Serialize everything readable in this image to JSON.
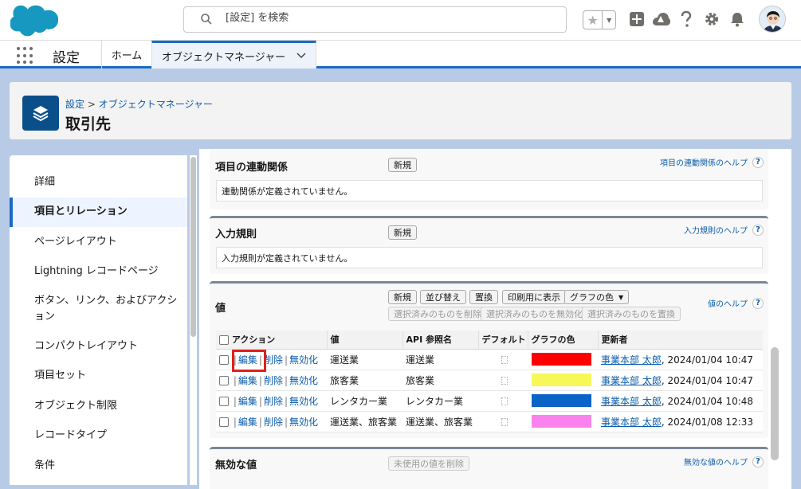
{
  "header": {
    "search_placeholder": "[設定] を検索",
    "icons": [
      "star-icon",
      "add-icon",
      "trailhead-icon",
      "help-icon",
      "setup-gear-icon",
      "notification-bell-icon",
      "avatar"
    ]
  },
  "nav": {
    "app_name": "設定",
    "tabs": [
      {
        "label": "ホーム"
      },
      {
        "label": "オブジェクトマネージャー"
      }
    ]
  },
  "page": {
    "breadcrumb_root": "設定",
    "breadcrumb_sep": " > ",
    "breadcrumb_current": "オブジェクトマネージャー",
    "title": "取引先"
  },
  "sidebar": {
    "items": [
      {
        "label": "詳細"
      },
      {
        "label": "項目とリレーション"
      },
      {
        "label": "ページレイアウト"
      },
      {
        "label": "Lightning レコードページ"
      },
      {
        "label": "ボタン、リンク、およびアクション"
      },
      {
        "label": "コンパクトレイアウト"
      },
      {
        "label": "項目セット"
      },
      {
        "label": "オブジェクト制限"
      },
      {
        "label": "レコードタイプ"
      },
      {
        "label": "条件"
      }
    ]
  },
  "dependencies": {
    "title": "項目の連動関係",
    "new_button": "新規",
    "help": "項目の連動関係のヘルプ",
    "help_q": "?",
    "empty": "連動関係が定義されていません。"
  },
  "validation": {
    "title": "入力規則",
    "new_button": "新規",
    "help": "入力規則のヘルプ",
    "help_q": "?",
    "empty": "入力規則が定義されていません。"
  },
  "values": {
    "title": "値",
    "buttons": {
      "new": "新規",
      "reorder": "並び替え",
      "replace": "置換",
      "print": "印刷用に表示",
      "chart_color": "グラフの色",
      "chart_color_caret": "▼",
      "delete_selected": "選択済みのものを削除",
      "disable_selected": "選択済みのものを無効化",
      "replace_selected": "選択済みのものを置換"
    },
    "help": "値のヘルプ",
    "help_q": "?",
    "columns": [
      "アクション",
      "値",
      "API 参照名",
      "デフォルト",
      "グラフの色",
      "更新者"
    ],
    "row_actions": {
      "edit": "編集",
      "delete": "削除",
      "disable": "無効化",
      "sep": "|"
    },
    "rows": [
      {
        "value": "運送業",
        "api": "運送業",
        "color": "#ff0000",
        "user": "事業本部 太郎",
        "date": ", 2024/01/04 10:47"
      },
      {
        "value": "旅客業",
        "api": "旅客業",
        "color": "#f7f757",
        "user": "事業本部 太郎",
        "date": ", 2024/01/04 10:47"
      },
      {
        "value": "レンタカー業",
        "api": "レンタカー業",
        "color": "#0a64c8",
        "user": "事業本部 太郎",
        "date": ", 2024/01/04 10:48"
      },
      {
        "value": "運送業、旅客業",
        "api": "運送業、旅客業",
        "color": "#fa82ef",
        "user": "事業本部 太郎",
        "date": ", 2024/01/08 12:33"
      }
    ]
  },
  "inactive": {
    "title": "無効な値",
    "delete_unused": "未使用の値を削除",
    "help": "無効な値のヘルプ",
    "help_q": "?"
  }
}
